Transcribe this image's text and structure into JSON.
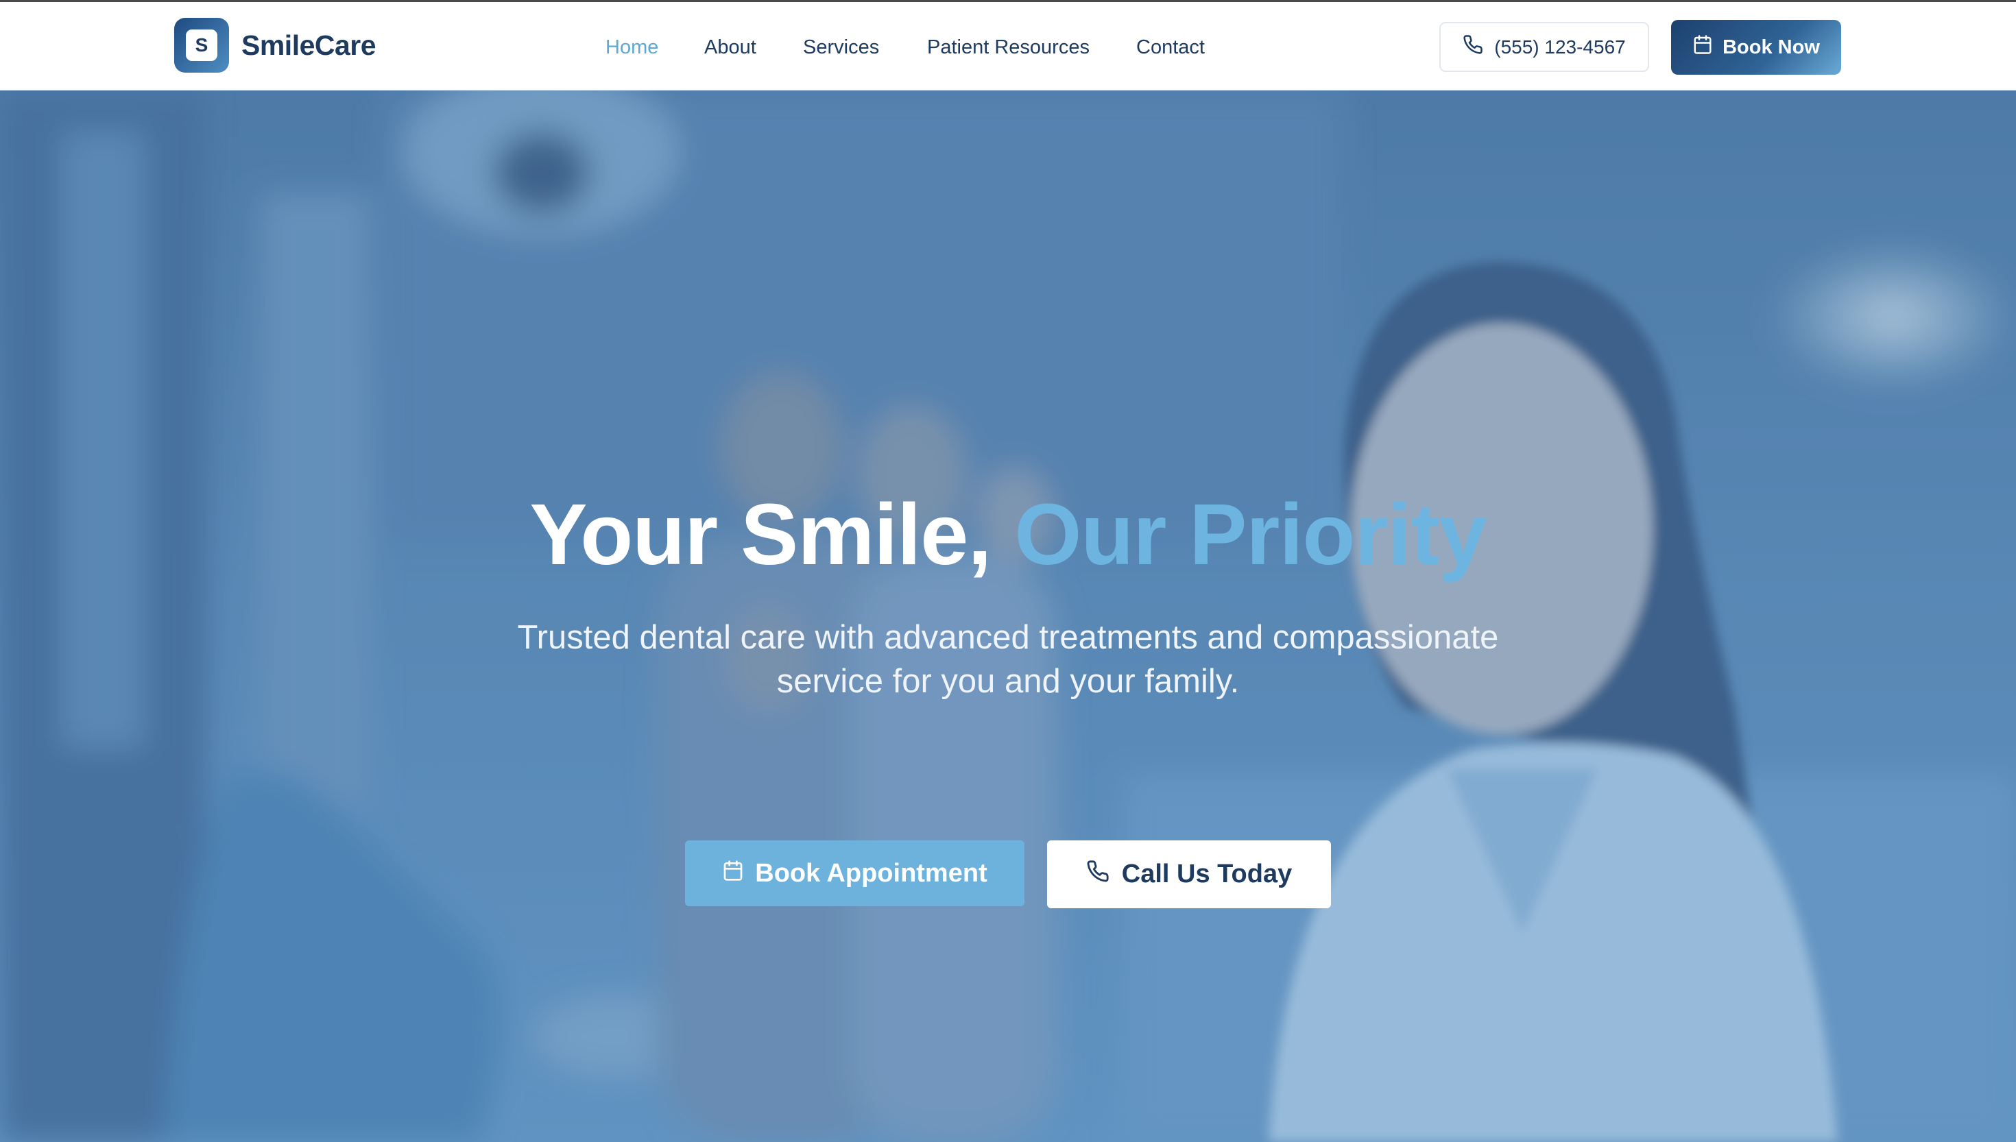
{
  "brand": {
    "logo_letter": "S",
    "name": "SmileCare"
  },
  "nav": {
    "items": [
      {
        "label": "Home",
        "active": true
      },
      {
        "label": "About"
      },
      {
        "label": "Services"
      },
      {
        "label": "Patient Resources"
      },
      {
        "label": "Contact"
      }
    ]
  },
  "header": {
    "phone_label": "(555) 123-4567",
    "book_label": "Book Now"
  },
  "hero": {
    "title_main": "Your Smile,",
    "title_accent": "Our Priority",
    "subtitle_line1": "Trusted dental care with advanced treatments and compassionate",
    "subtitle_line2": "service for you and your family.",
    "primary_cta": "Book Appointment",
    "secondary_cta": "Call Us Today"
  },
  "icons": {
    "phone": "phone-icon",
    "calendar": "calendar-icon"
  },
  "colors": {
    "brand_dark": "#1e3a5f",
    "accent": "#5ea8d4",
    "accent_button": "#6cb2dc",
    "hero_tint": "#5c8ab6"
  }
}
